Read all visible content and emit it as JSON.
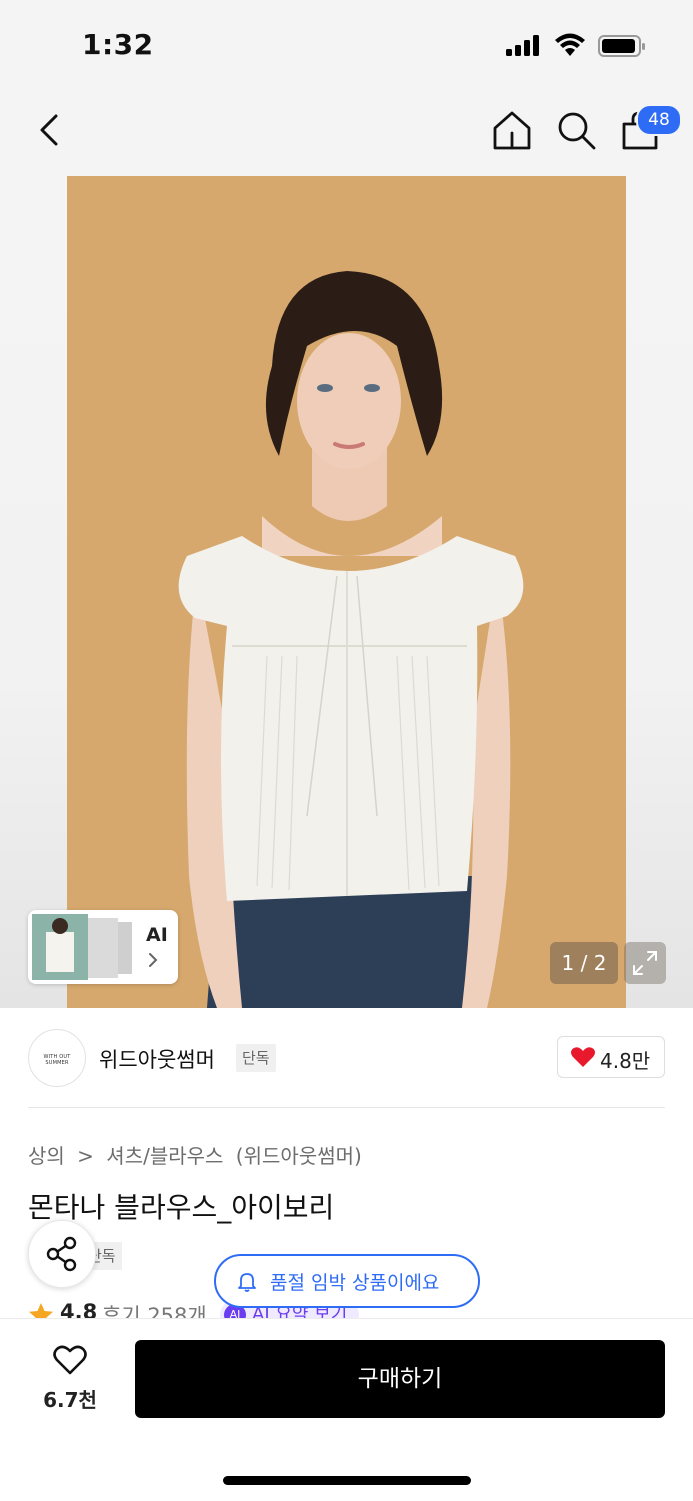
{
  "status_bar": {
    "time": "1:32"
  },
  "nav": {
    "cart_count": "48"
  },
  "hero": {
    "ai_label": "AI",
    "page_indicator": "1 / 2",
    "accent_color": "#d7a96f"
  },
  "brand": {
    "logo_text": "WITH OUT SUMMER",
    "name": "위드아웃썸머",
    "exclusive_tag": "단독",
    "like_count": "4.8만"
  },
  "product": {
    "breadcrumb": [
      "상의",
      ">",
      "셔츠/블라우스",
      "(위드아웃썸머)"
    ],
    "title": "몬타나 블라우스_아이보리",
    "exclusive_tag": "단독",
    "stock_notice": "품절 임박 상품이에요",
    "rating": "4.8",
    "review_count": "후기 258개",
    "ai_summary": "AI 요약 보기"
  },
  "bottom_bar": {
    "wish_count": "6.7천",
    "buy_label": "구매하기"
  },
  "colors": {
    "brand_blue": "#2f6cf6",
    "heart_red": "#e8192c",
    "buy_black": "#000000"
  }
}
